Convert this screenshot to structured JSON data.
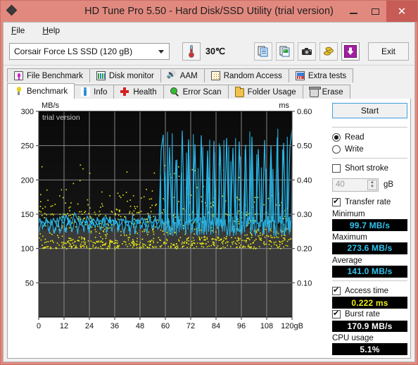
{
  "window": {
    "title": "HD Tune Pro 5.50 - Hard Disk/SSD Utility (trial version)",
    "app_icon": "diamond-logo-icon",
    "minimize_label": "–",
    "maximize_label": "□",
    "close_label": "✕",
    "titlebar_color": "#e2897f",
    "close_button_color": "#c75b55"
  },
  "menu": {
    "items": [
      "File",
      "Help"
    ]
  },
  "toolbar": {
    "drive": "Corsair Force LS SSD (120 gB)",
    "temperature": "30℃",
    "icons": [
      "copy-text-icon",
      "copy-image-icon",
      "camera-icon",
      "coins-icon",
      "download-arrow-icon"
    ],
    "exit_label": "Exit"
  },
  "tabs": {
    "row1": [
      {
        "label": "File Benchmark",
        "icon": "file-benchmark-icon",
        "active": false
      },
      {
        "label": "Disk monitor",
        "icon": "bar-chart-icon",
        "active": false
      },
      {
        "label": "AAM",
        "icon": "speaker-icon",
        "active": false
      },
      {
        "label": "Random Access",
        "icon": "scatter-icon",
        "active": false
      },
      {
        "label": "Extra tests",
        "icon": "extra-tests-icon",
        "active": false
      }
    ],
    "row2": [
      {
        "label": "Benchmark",
        "icon": "lightbulb-icon",
        "active": true
      },
      {
        "label": "Info",
        "icon": "info-icon",
        "active": false
      },
      {
        "label": "Health",
        "icon": "health-cross-icon",
        "active": false
      },
      {
        "label": "Error Scan",
        "icon": "magnifier-icon",
        "active": false
      },
      {
        "label": "Folder Usage",
        "icon": "folder-icon",
        "active": false
      },
      {
        "label": "Erase",
        "icon": "trash-icon",
        "active": false
      }
    ]
  },
  "panel": {
    "start_label": "Start",
    "mode_read": "Read",
    "mode_write": "Write",
    "mode_selected": "Read",
    "short_stroke_label": "Short stroke",
    "short_stroke_checked": false,
    "short_stroke_value": "40",
    "short_stroke_unit": "gB",
    "transfer_rate_label": "Transfer rate",
    "transfer_rate_checked": true,
    "minimum_label": "Minimum",
    "minimum_value": "99.7 MB/s",
    "maximum_label": "Maximum",
    "maximum_value": "273.6 MB/s",
    "average_label": "Average",
    "average_value": "141.0 MB/s",
    "access_time_label": "Access time",
    "access_time_checked": true,
    "access_time_value": "0.222 ms",
    "burst_rate_label": "Burst rate",
    "burst_rate_checked": true,
    "burst_rate_value": "170.9 MB/s",
    "cpu_usage_label": "CPU usage",
    "cpu_usage_value": "5.1%"
  },
  "chart_data": {
    "type": "line",
    "title": "",
    "watermark": "trial version",
    "xlabel": "gB",
    "ylabel": "MB/s",
    "y2label": "ms",
    "xlim": [
      0,
      120
    ],
    "ylim": [
      0,
      300
    ],
    "y2lim": [
      0,
      0.6
    ],
    "grid": true,
    "x_ticks": [
      0,
      12,
      24,
      36,
      48,
      60,
      72,
      84,
      96,
      108,
      120
    ],
    "y_ticks": [
      50,
      100,
      150,
      200,
      250,
      300
    ],
    "y2_ticks": [
      0.1,
      0.2,
      0.3,
      0.4,
      0.5,
      0.6
    ],
    "plot_bg_top": "#0a0a0a",
    "plot_bg_bottom": "#3a3a3a",
    "grid_color": "#9a9a9a",
    "series": [
      {
        "name": "Transfer rate",
        "color": "#29b6e8",
        "axis": "left",
        "unit": "MB/s",
        "x": [
          0,
          1,
          2,
          3,
          4,
          5,
          6,
          7,
          8,
          9,
          10,
          11,
          12,
          13,
          14,
          15,
          16,
          17,
          18,
          19,
          20,
          21,
          22,
          23,
          24,
          25,
          26,
          27,
          28,
          29,
          30,
          31,
          32,
          33,
          34,
          35,
          36,
          37,
          38,
          39,
          40,
          41,
          42,
          43,
          44,
          45,
          46,
          47,
          48,
          49,
          50,
          51,
          52,
          53,
          54,
          55,
          56,
          57,
          58,
          59,
          60,
          61,
          62,
          63,
          64,
          65,
          66,
          67,
          68,
          69,
          70,
          71,
          72,
          73,
          74,
          75,
          76,
          77,
          78,
          79,
          80,
          81,
          82,
          83,
          84,
          85,
          86,
          87,
          88,
          89,
          90,
          91,
          92,
          93,
          94,
          95,
          96,
          97,
          98,
          99,
          100,
          101,
          102,
          103,
          104,
          105,
          106,
          107,
          108,
          109,
          110,
          111,
          112,
          113,
          114,
          115,
          116,
          117,
          118,
          119,
          120
        ],
        "values": [
          122,
          137,
          139,
          135,
          141,
          138,
          134,
          144,
          137,
          132,
          146,
          140,
          136,
          150,
          138,
          133,
          141,
          152,
          145,
          139,
          134,
          142,
          137,
          147,
          140,
          136,
          143,
          138,
          134,
          141,
          139,
          132,
          146,
          140,
          137,
          142,
          135,
          139,
          131,
          136,
          143,
          137,
          133,
          140,
          138,
          134,
          142,
          136,
          139,
          145,
          136,
          132,
          148,
          140,
          137,
          143,
          135,
          140,
          244,
          266,
          140,
          136,
          248,
          141,
          137,
          229,
          138,
          142,
          272,
          140,
          136,
          259,
          139,
          143,
          252,
          138,
          141,
          265,
          137,
          140,
          243,
          139,
          136,
          257,
          142,
          138,
          249,
          140,
          137,
          261,
          139,
          142,
          247,
          138,
          141,
          256,
          140,
          136,
          251,
          139,
          143,
          263,
          137,
          140,
          245,
          138,
          142,
          258,
          139,
          136,
          250,
          141,
          138,
          262,
          140,
          137,
          254,
          139,
          142,
          248,
          274
        ]
      },
      {
        "name": "Access time",
        "color": "#eded12",
        "axis": "right",
        "unit": "ms",
        "mean": 0.222,
        "marker": "dot",
        "note": "scattered yellow dots, dense band between 0.20 and 0.33 ms with sparse outliers up to 0.45 ms"
      }
    ],
    "summary": {
      "minimum_mbs": 99.7,
      "maximum_mbs": 273.6,
      "average_mbs": 141.0,
      "access_time_ms": 0.222,
      "burst_rate_mbs": 170.9,
      "cpu_usage_pct": 5.1
    }
  }
}
